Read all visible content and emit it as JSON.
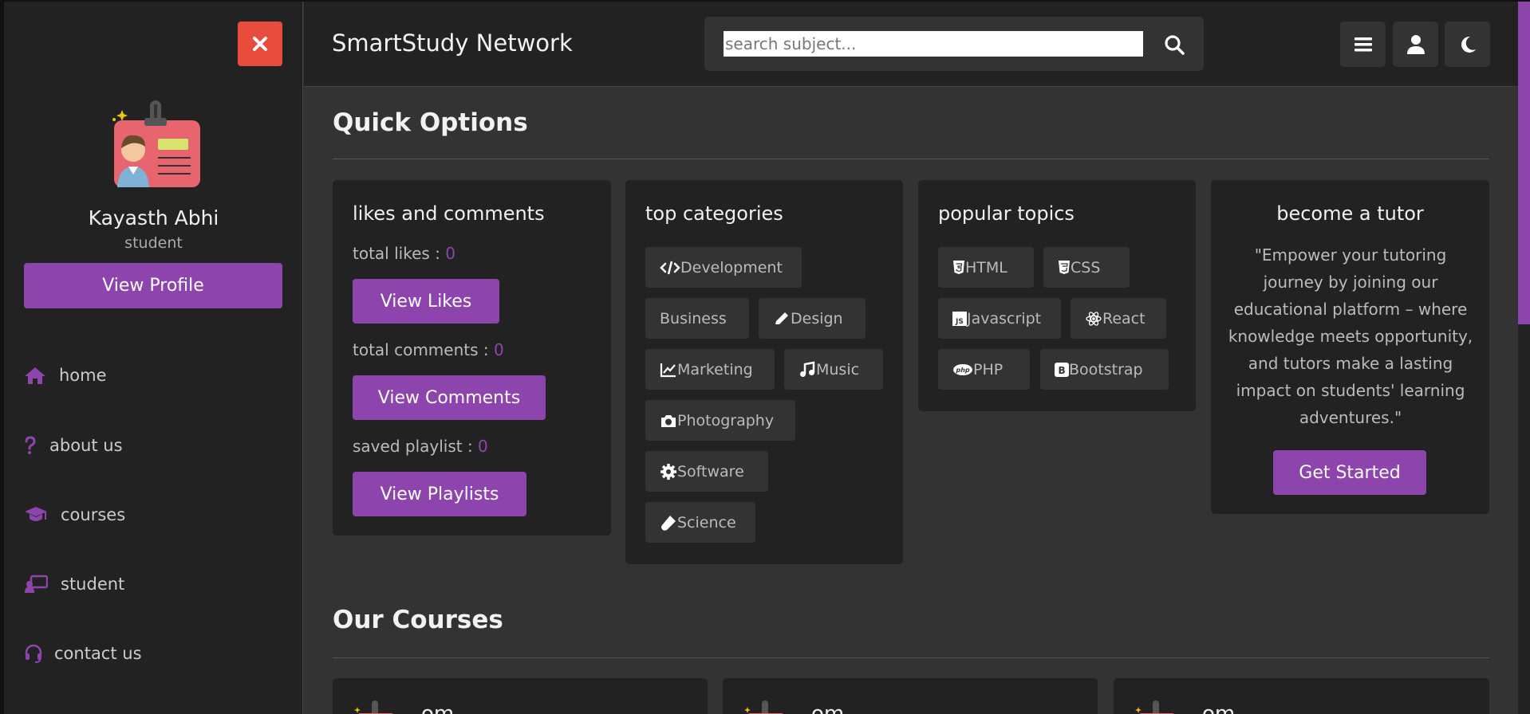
{
  "sidebar": {
    "close_icon": "times-icon",
    "avatar": "id-badge-avatar",
    "name": "Kayasth Abhi",
    "role": "student",
    "view_profile": "View Profile",
    "nav": [
      {
        "label": "home",
        "icon": "home-icon"
      },
      {
        "label": "about us",
        "icon": "question-icon"
      },
      {
        "label": "courses",
        "icon": "graduation-cap-icon"
      },
      {
        "label": "student",
        "icon": "chalkboard-user-icon"
      },
      {
        "label": "contact us",
        "icon": "headset-icon"
      }
    ]
  },
  "header": {
    "logo": "SmartStudy Network",
    "search_placeholder": "search subject...",
    "search_value": ""
  },
  "quick": {
    "title": "Quick Options",
    "likes": {
      "title": "likes and comments",
      "total_likes_label": "total likes : ",
      "total_likes": "0",
      "view_likes": "View Likes",
      "total_comments_label": "total comments : ",
      "total_comments": "0",
      "view_comments": "View Comments",
      "saved_label": "saved playlist : ",
      "saved": "0",
      "view_playlists": "View Playlists"
    },
    "categories": {
      "title": "top categories",
      "items": [
        "Development",
        "Business",
        "Design",
        "Marketing",
        "Music",
        "Photography",
        "Software",
        "Science"
      ]
    },
    "topics": {
      "title": "popular topics",
      "items": [
        "HTML",
        "CSS",
        "Javascript",
        "React",
        "PHP",
        "Bootstrap"
      ]
    },
    "tutor": {
      "title": "become a tutor",
      "quote": "\"Empower your tutoring journey by joining our educational platform – where knowledge meets opportunity, and tutors make a lasting impact on students' learning adventures.\"",
      "button": "Get Started"
    }
  },
  "courses": {
    "title": "Our Courses",
    "items": [
      {
        "name": "om"
      },
      {
        "name": "om"
      },
      {
        "name": "om"
      }
    ]
  },
  "colors": {
    "accent": "#8e44ad",
    "close": "#e74c3c",
    "panel": "#222222",
    "background": "#333333"
  }
}
